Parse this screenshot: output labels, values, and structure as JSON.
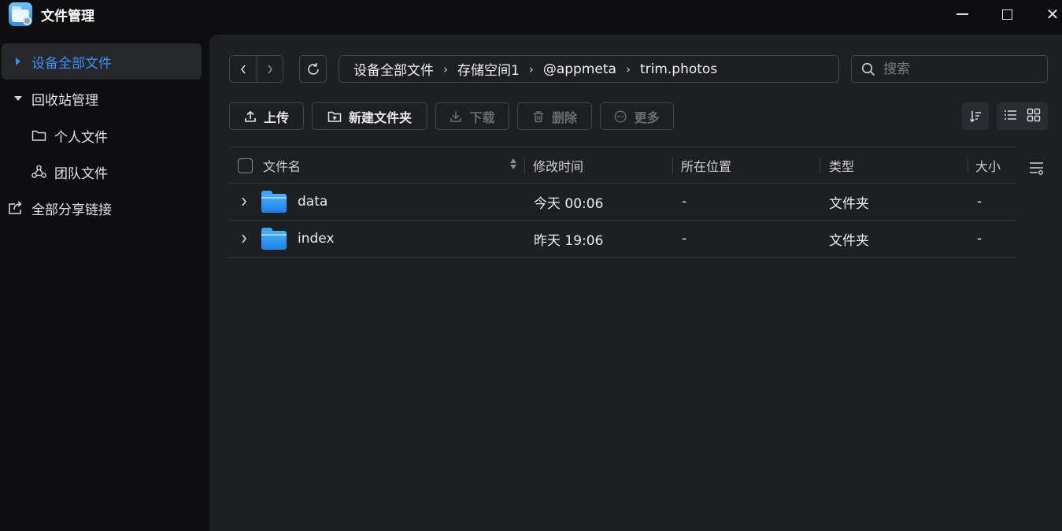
{
  "app": {
    "title": "文件管理"
  },
  "sidebar": {
    "items": [
      {
        "label": "设备全部文件",
        "active": true
      },
      {
        "label": "回收站管理",
        "expanded": true
      },
      {
        "label": "个人文件"
      },
      {
        "label": "团队文件"
      },
      {
        "label": "全部分享链接"
      }
    ]
  },
  "breadcrumb": [
    "设备全部文件",
    "存储空间1",
    "@appmeta",
    "trim.photos"
  ],
  "search": {
    "placeholder": "搜索",
    "value": ""
  },
  "toolbar": {
    "upload": "上传",
    "new_folder": "新建文件夹",
    "download": "下载",
    "delete": "删除",
    "more": "更多"
  },
  "table": {
    "columns": [
      "文件名",
      "修改时间",
      "所在位置",
      "类型",
      "大小"
    ],
    "rows": [
      {
        "name": "data",
        "modified": "今天 00:06",
        "location": "-",
        "type": "文件夹",
        "size": "-"
      },
      {
        "name": "index",
        "modified": "昨天 19:06",
        "location": "-",
        "type": "文件夹",
        "size": "-"
      }
    ]
  },
  "colors": {
    "accent": "#3d8ff6",
    "background": "#0e0e10",
    "panel": "#1e1f22"
  }
}
